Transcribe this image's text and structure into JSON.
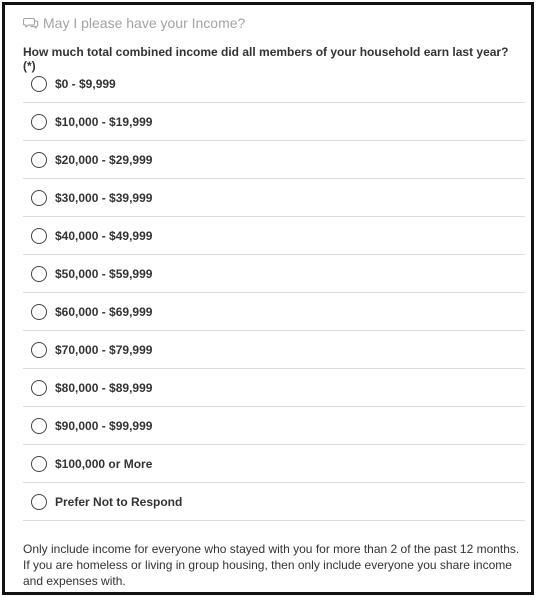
{
  "header": {
    "icon": "chat-bubbles-icon",
    "title": "May I please have your Income?"
  },
  "question": "How much total combined income did all members of your household earn last year? (*)",
  "options": [
    {
      "label": "$0 - $9,999"
    },
    {
      "label": "$10,000 - $19,999"
    },
    {
      "label": "$20,000 - $29,999"
    },
    {
      "label": "$30,000 - $39,999"
    },
    {
      "label": "$40,000 - $49,999"
    },
    {
      "label": "$50,000 - $59,999"
    },
    {
      "label": "$60,000 - $69,999"
    },
    {
      "label": "$70,000 - $79,999"
    },
    {
      "label": "$80,000 - $89,999"
    },
    {
      "label": "$90,000 - $99,999"
    },
    {
      "label": "$100,000 or More"
    },
    {
      "label": "Prefer Not to Respond"
    }
  ],
  "note": {
    "line1": "Only include income for everyone who stayed with you for more than 2 of the past 12 months.",
    "line2": "If you are homeless or living in group housing, then only include everyone you share income and expenses with."
  }
}
